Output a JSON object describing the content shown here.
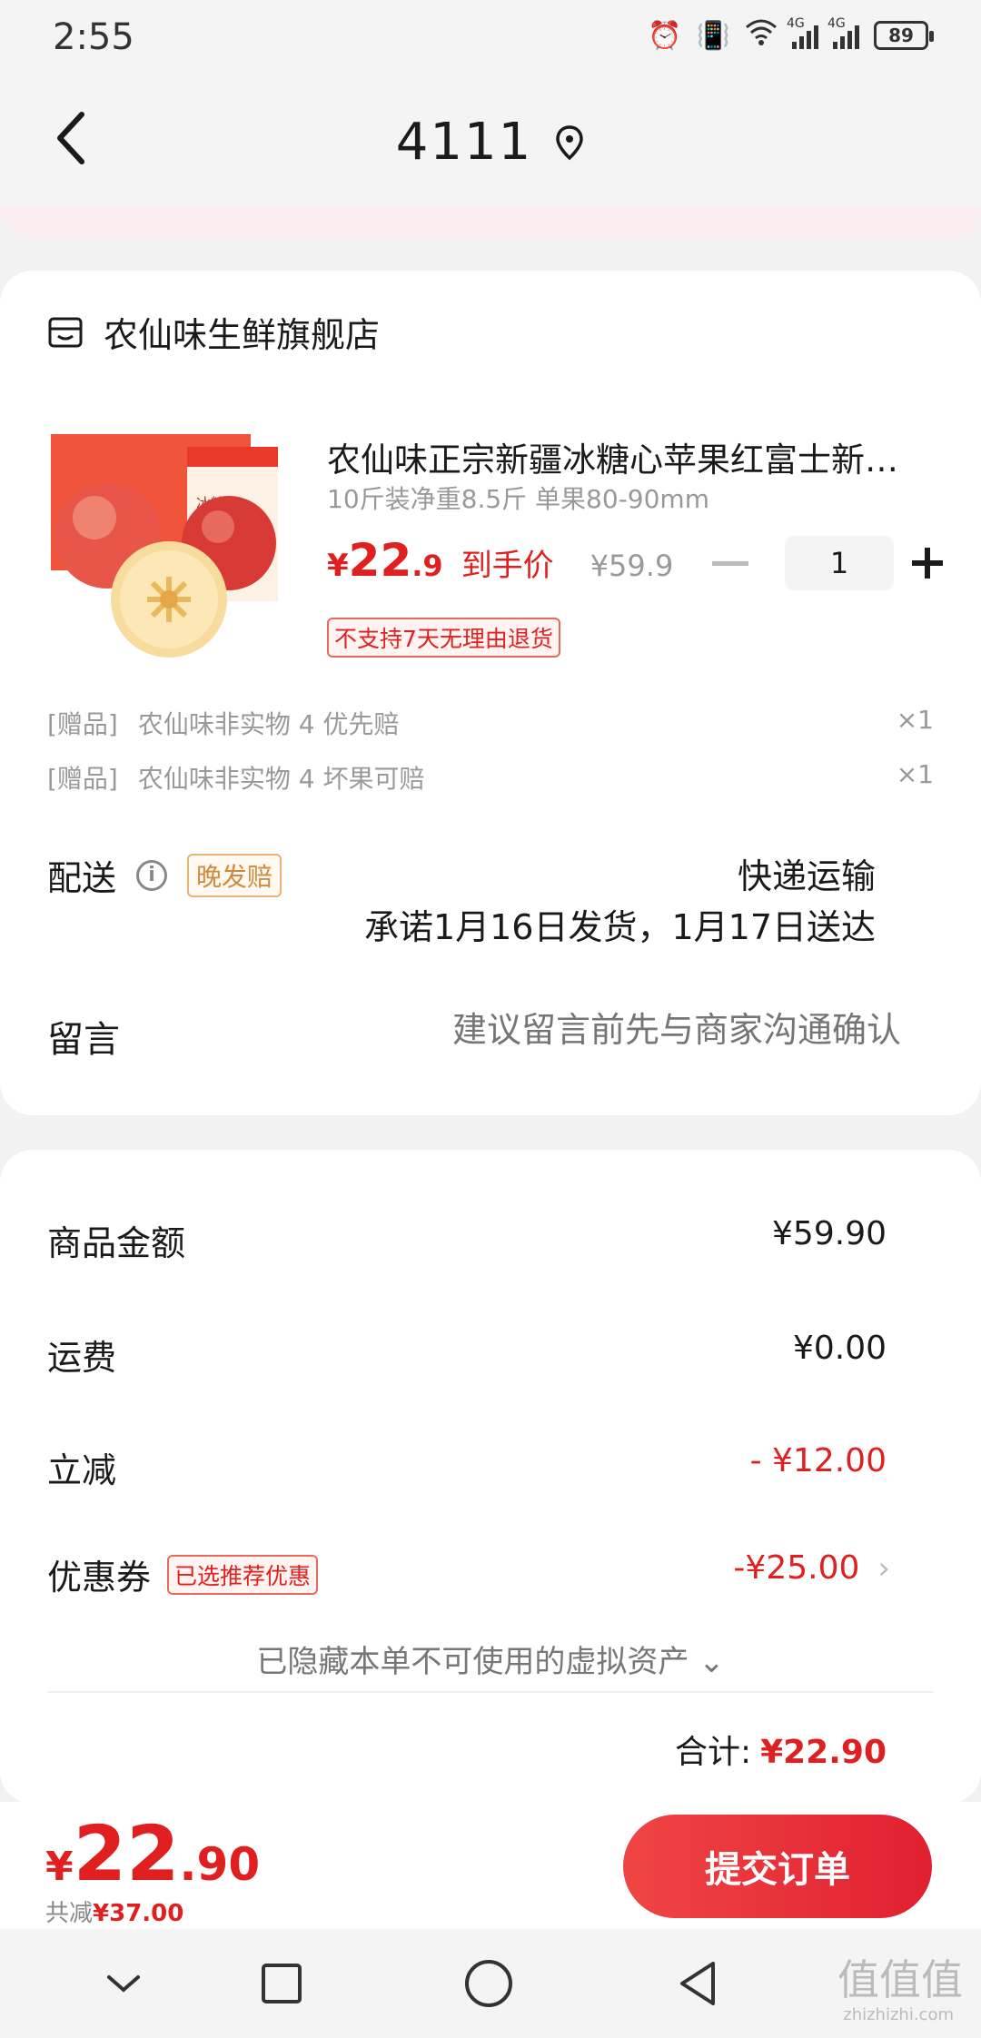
{
  "status": {
    "time": "2:55",
    "battery": "89",
    "net1": "4G",
    "net2": "4G"
  },
  "header": {
    "title": "4111"
  },
  "shop": {
    "name": "农仙味生鲜旗舰店"
  },
  "product": {
    "title": "农仙味正宗新疆冰糖心苹果红富士新鲜水果",
    "spec": "10斤装净重8.5斤 单果80-90mm",
    "price_symbol": "¥",
    "price_int": "22",
    "price_dec": ".9",
    "price_label": "到手价",
    "original_price": "¥59.9",
    "quantity": "1",
    "return_badge": "不支持7天无理由退货",
    "box_text": "冰糖心"
  },
  "gifts": [
    {
      "tag": "[赠品]",
      "name": "农仙味非实物 4 优先赔",
      "qty": "×1"
    },
    {
      "tag": "[赠品]",
      "name": "农仙味非实物 4 坏果可赔",
      "qty": "×1"
    }
  ],
  "delivery": {
    "label": "配送",
    "info": "i",
    "badge": "晚发赔",
    "method": "快递运输",
    "promise": "承诺1月16日发货，1月17日送达"
  },
  "message": {
    "label": "留言",
    "placeholder": "建议留言前先与商家沟通确认"
  },
  "summary": {
    "goods_label": "商品金额",
    "goods_value": "¥59.90",
    "shipping_label": "运费",
    "shipping_value": "¥0.00",
    "discount_label": "立减",
    "discount_value": "- ¥12.00",
    "coupon_label": "优惠券",
    "coupon_badge": "已选推荐优惠",
    "coupon_value": "-¥25.00",
    "hidden_assets": "已隐藏本单不可使用的虚拟资产 ⌄",
    "total_label": "合计:",
    "total_value": "¥22.90"
  },
  "footer": {
    "pay_symbol": "¥",
    "pay_int": "22",
    "pay_dec": ".90",
    "saved_label": "共减",
    "saved_value": "¥37.00",
    "submit_label": "提交订单"
  },
  "watermark": {
    "text": "值值值",
    "sub": "zhizhizhi.com"
  },
  "colors": {
    "accent": "#e02020",
    "background": "#f2f2f2"
  }
}
